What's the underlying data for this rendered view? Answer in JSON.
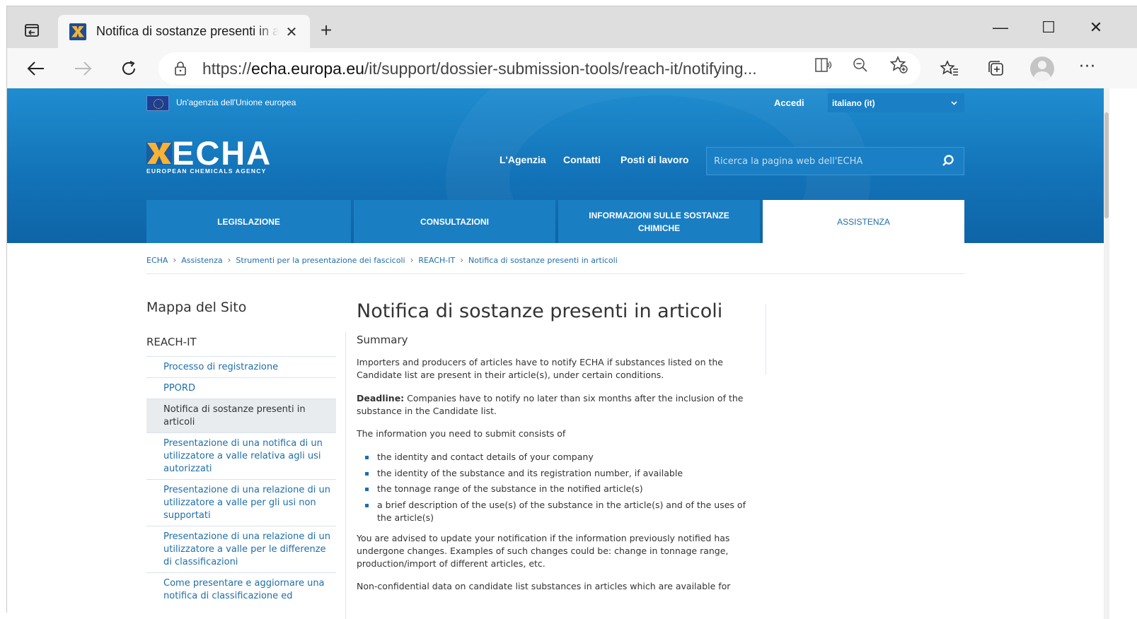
{
  "browser": {
    "tab_title": "Notifica di sostanze presenti in articoli",
    "url_prefix": "https://",
    "url_host": "echa.europa.eu",
    "url_path": "/it/support/dossier-submission-tools/reach-it/notifying...",
    "icons": [
      "tab-actions-icon",
      "close-icon",
      "plus-icon",
      "minimize-icon",
      "maximize-icon",
      "window-close-icon",
      "back-arrow-icon",
      "forward-arrow-icon",
      "refresh-icon",
      "lock-icon",
      "reader-view-icon",
      "zoom-out-icon",
      "add-favorite-icon",
      "favorites-icon",
      "collections-icon",
      "profile-icon",
      "more-icon"
    ]
  },
  "header": {
    "eu_text": "Un'agenzia dell'Unione europea",
    "login": "Accedi",
    "language": "italiano (it)",
    "logo_word": "ECHA",
    "logo_sub": "EUROPEAN CHEMICALS AGENCY",
    "links": [
      "L'Agenzia",
      "Contatti",
      "Posti di lavoro"
    ],
    "search_placeholder": "Ricerca la pagina web dell'ECHA",
    "main_nav": [
      "LEGISLAZIONE",
      "CONSULTAZIONI",
      "INFORMAZIONI SULLE SOSTANZE CHIMICHE",
      "ASSISTENZA"
    ],
    "active_tab": "ASSISTENZA",
    "brand_color": "#1373b8"
  },
  "breadcrumb": [
    "ECHA",
    "Assistenza",
    "Strumenti per la presentazione dei fascicoli",
    "REACH-IT",
    "Notifica di sostanze presenti in articoli"
  ],
  "sidebar": {
    "title": "Mappa del Sito",
    "section": "REACH-IT",
    "items": [
      "Processo di registrazione",
      "PPORD",
      "Notifica di sostanze presenti in articoli",
      "Presentazione di una notifica di un utilizzatore a valle relativa agli usi autorizzati",
      "Presentazione di una relazione di un utilizzatore a valle per gli usi non supportati",
      "Presentazione di una relazione di un utilizzatore a valle per le differenze di classificazioni",
      "Come presentare e aggiornare una notifica di classificazione ed"
    ],
    "active_item": "Notifica di sostanze presenti in articoli"
  },
  "main": {
    "title": "Notifica di sostanze presenti in articoli",
    "summary_heading": "Summary",
    "intro": "Importers and producers of articles have to notify ECHA if substances listed on the Candidate list are present in their article(s), under certain conditions.",
    "deadline_label": "Deadline:",
    "deadline_text": " Companies have to notify no later than six months after the inclusion of the substance in the Candidate list.",
    "info_intro": "The information you need to submit consists of",
    "bullets": [
      "the identity and contact details of your company",
      "the identity of the substance and its registration number, if available",
      "the tonnage range of the substance in the notified article(s)",
      "a brief description of the use(s) of the substance in the article(s) and of the uses of the article(s)"
    ],
    "update_text": "You are advised to update your notification if the information previously notified has undergone changes. Examples of such changes could be: change in tonnage range, production/import of different articles, etc.",
    "nonconf_text": "Non-confidential data on candidate list substances in articles which are available for"
  }
}
